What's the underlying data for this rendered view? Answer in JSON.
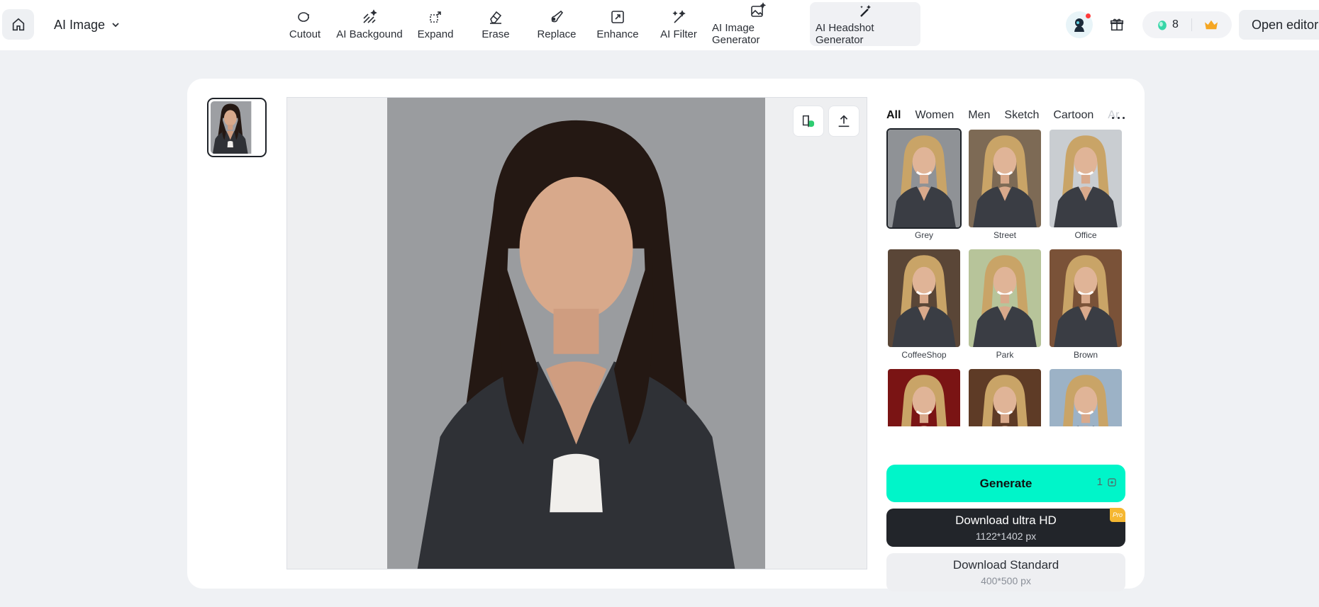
{
  "header": {
    "home_icon": "home-icon",
    "app_name": "AI Image",
    "tools": [
      {
        "label": "Cutout",
        "icon": "cutout-icon"
      },
      {
        "label": "AI Backgound",
        "icon": "ai-background-icon"
      },
      {
        "label": "Expand",
        "icon": "expand-icon"
      },
      {
        "label": "Erase",
        "icon": "erase-icon"
      },
      {
        "label": "Replace",
        "icon": "replace-icon"
      },
      {
        "label": "Enhance",
        "icon": "enhance-icon"
      },
      {
        "label": "AI Filter",
        "icon": "ai-filter-icon"
      },
      {
        "label": "AI Image Generator",
        "icon": "ai-image-generator-icon"
      },
      {
        "label": "AI Headshot Generator",
        "icon": "ai-headshot-generator-icon",
        "active": true
      }
    ],
    "credits": "8",
    "open_editor": "Open editor"
  },
  "styles": {
    "categories": [
      "All",
      "Women",
      "Men",
      "Sketch",
      "Cartoon",
      "Ar"
    ],
    "active_category": "All",
    "items": [
      {
        "label": "Grey",
        "selected": true,
        "bg": "#8f9296"
      },
      {
        "label": "Street",
        "bg": "#7d6a55"
      },
      {
        "label": "Office",
        "bg": "#c9cdd1"
      },
      {
        "label": "CoffeeShop",
        "bg": "#5a4637"
      },
      {
        "label": "Park",
        "bg": "#b7c49a"
      },
      {
        "label": "Brown",
        "bg": "#7a5238"
      },
      {
        "label": "",
        "bg": "#7a1414"
      },
      {
        "label": "",
        "bg": "#5e3b26"
      },
      {
        "label": "",
        "bg": "#9cb2c6"
      }
    ]
  },
  "actions": {
    "generate": "Generate",
    "generate_cost": "1",
    "download_hd": "Download ultra HD",
    "download_hd_size": "1122*1402 px",
    "pro_badge": "Pro",
    "download_std": "Download Standard",
    "download_std_size": "400*500 px"
  },
  "colors": {
    "generate": "#00f5c9",
    "download_hd": "#22252a",
    "pro_badge": "#f5b731"
  }
}
